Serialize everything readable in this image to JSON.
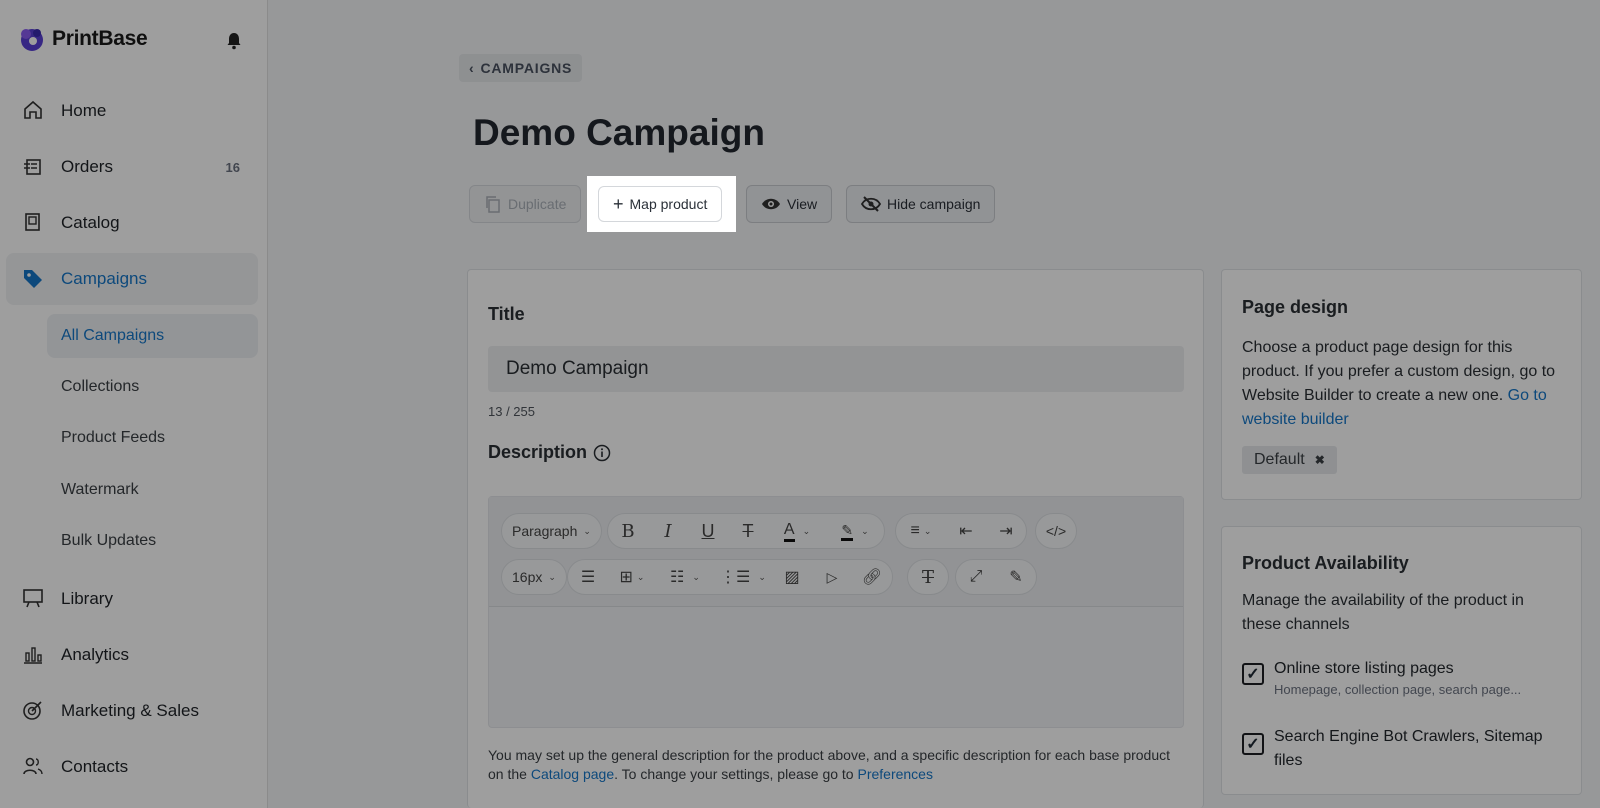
{
  "brand": {
    "name": "PrintBase"
  },
  "sidebar": {
    "items": [
      {
        "label": "Home",
        "icon": "home-icon"
      },
      {
        "label": "Orders",
        "icon": "orders-icon",
        "count": "16"
      },
      {
        "label": "Catalog",
        "icon": "catalog-icon"
      },
      {
        "label": "Campaigns",
        "icon": "tag-icon"
      },
      {
        "label": "Library",
        "icon": "library-icon"
      },
      {
        "label": "Analytics",
        "icon": "analytics-icon"
      },
      {
        "label": "Marketing & Sales",
        "icon": "target-icon"
      },
      {
        "label": "Contacts",
        "icon": "contacts-icon"
      }
    ],
    "sub_items": [
      {
        "label": "All Campaigns"
      },
      {
        "label": "Collections"
      },
      {
        "label": "Product Feeds"
      },
      {
        "label": "Watermark"
      },
      {
        "label": "Bulk Updates"
      }
    ]
  },
  "header": {
    "back_label": "CAMPAIGNS",
    "title": "Demo Campaign",
    "actions": {
      "duplicate": "Duplicate",
      "map_product": "Map product",
      "view": "View",
      "hide_campaign": "Hide campaign"
    }
  },
  "main_card": {
    "title_label": "Title",
    "title_value": "Demo Campaign",
    "counter": "13 / 255",
    "description_label": "Description",
    "editor": {
      "paragraph": "Paragraph",
      "font_size": "16px"
    },
    "help_text_1": "You may set up the general description for the product above, and a specific description for each base product on the ",
    "help_link_1": "Catalog page",
    "help_text_2": ". To change your settings, please go to ",
    "help_link_2": "Preferences"
  },
  "page_design": {
    "title": "Page design",
    "text": "Choose a product page design for this product. If you prefer a custom design, go to Website Builder to create a new one. ",
    "link": "Go to website builder",
    "tag": "Default"
  },
  "availability": {
    "title": "Product Availability",
    "text": "Manage the availability of the product in these channels",
    "options": [
      {
        "label": "Online store listing pages",
        "sub": "Homepage, collection page, search page..."
      },
      {
        "label": "Search Engine Bot Crawlers, Sitemap files",
        "sub": ""
      }
    ]
  },
  "colors": {
    "accent": "#1677c8",
    "overlay": "rgba(0,0,0,0.38)"
  }
}
